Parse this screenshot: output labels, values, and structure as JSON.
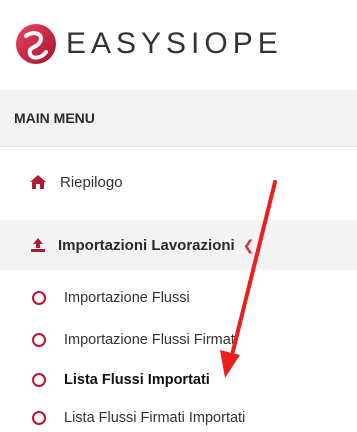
{
  "brand": {
    "name": "EASYSIOPE",
    "accent": "#d6334f"
  },
  "menu": {
    "header": "MAIN MENU",
    "riepilogo": "Riepilogo",
    "group": {
      "label": "Importazioni Lavorazioni",
      "items": [
        {
          "label": "Importazione Flussi",
          "active": false
        },
        {
          "label": "Importazione Flussi Firmati",
          "active": false
        },
        {
          "label": "Lista Flussi Importati",
          "active": true
        },
        {
          "label": "Lista Flussi Firmati Importati",
          "active": false
        }
      ]
    }
  },
  "annotation": {
    "color": "#e8211f"
  }
}
